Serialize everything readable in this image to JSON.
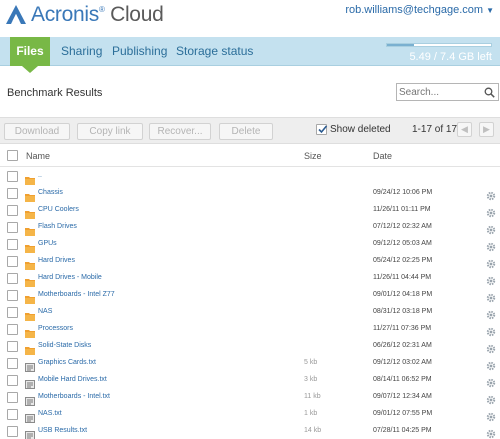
{
  "brand": {
    "name_main": "Acronis",
    "trademark": "®",
    "name_sub": " Cloud",
    "color": "#3a78b8"
  },
  "user": {
    "email": "rob.williams@techgage.com"
  },
  "nav": {
    "tabs": [
      {
        "label": "Files",
        "active": true
      },
      {
        "label": "Sharing"
      },
      {
        "label": "Publishing"
      },
      {
        "label": "Storage status"
      }
    ],
    "storage_text": "5.49 / 7.4 GB left",
    "storage_used_fraction": 0.26
  },
  "folder_title": "Benchmark Results",
  "search": {
    "placeholder": "Search..."
  },
  "toolbar": {
    "download": "Download",
    "copy_link": "Copy link",
    "recover": "Recover...",
    "delete": "Delete",
    "show_deleted": "Show deleted",
    "show_deleted_checked": true,
    "pagination": "1-17 of 17"
  },
  "columns": {
    "name": "Name",
    "size": "Size",
    "date": "Date"
  },
  "rows": [
    {
      "type": "folder",
      "name": "..",
      "size": "",
      "date": ""
    },
    {
      "type": "folder",
      "name": "Chassis",
      "size": "",
      "date": "09/24/12 10:06 PM"
    },
    {
      "type": "folder",
      "name": "CPU Coolers",
      "size": "",
      "date": "11/26/11 01:11 PM"
    },
    {
      "type": "folder",
      "name": "Flash Drives",
      "size": "",
      "date": "07/12/12 02:32 AM"
    },
    {
      "type": "folder",
      "name": "GPUs",
      "size": "",
      "date": "09/12/12 05:03 AM"
    },
    {
      "type": "folder",
      "name": "Hard Drives",
      "size": "",
      "date": "05/24/12 02:25 PM"
    },
    {
      "type": "folder",
      "name": "Hard Drives - Mobile",
      "size": "",
      "date": "11/26/11 04:44 PM"
    },
    {
      "type": "folder",
      "name": "Motherboards - Intel Z77",
      "size": "",
      "date": "09/01/12 04:18 PM"
    },
    {
      "type": "folder",
      "name": "NAS",
      "size": "",
      "date": "08/31/12 03:18 PM"
    },
    {
      "type": "folder",
      "name": "Processors",
      "size": "",
      "date": "11/27/11 07:36 PM"
    },
    {
      "type": "folder",
      "name": "Solid-State Disks",
      "size": "",
      "date": "06/26/12 02:31 AM"
    },
    {
      "type": "file",
      "name": "Graphics Cards.txt",
      "size": "5 kb",
      "date": "09/12/12 03:02 AM"
    },
    {
      "type": "file",
      "name": "Mobile Hard Drives.txt",
      "size": "3 kb",
      "date": "08/14/11 06:52 PM"
    },
    {
      "type": "file",
      "name": "Motherboards - Intel.txt",
      "size": "11 kb",
      "date": "09/07/12 12:34 AM"
    },
    {
      "type": "file",
      "name": "NAS.txt",
      "size": "1 kb",
      "date": "09/01/12 07:55 PM"
    },
    {
      "type": "file",
      "name": "USB Results.txt",
      "size": "14 kb",
      "date": "07/28/11 04:25 PM"
    }
  ],
  "colors": {
    "active_tab": "#78b846",
    "nav_bg": "#c4e1ef",
    "folder": "#f0a030",
    "link": "#2a6aa8"
  },
  "icons": {
    "folder": "folder-icon",
    "file": "text-file-icon",
    "actions": "gear-icon",
    "search": "search-icon"
  }
}
